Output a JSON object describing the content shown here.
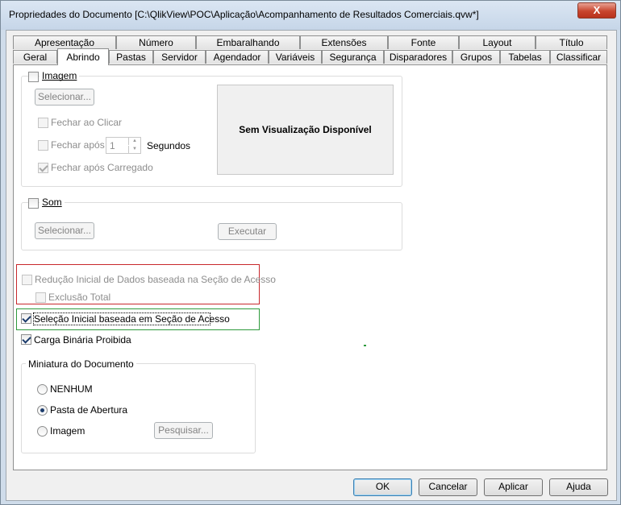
{
  "window": {
    "title": "Propriedades do Documento [C:\\QlikView\\POC\\Aplicação\\Acompanhamento de Resultados Comerciais.qvw*]",
    "close_label": "X"
  },
  "tabs_row1": [
    "Apresentação",
    "Número",
    "Embaralhando",
    "Extensões",
    "Fonte",
    "Layout",
    "Título"
  ],
  "tabs_row2": [
    "Geral",
    "Abrindo",
    "Pastas",
    "Servidor",
    "Agendador",
    "Variáveis",
    "Segurança",
    "Disparadores",
    "Grupos",
    "Tabelas",
    "Classificar"
  ],
  "image_group": {
    "label": "Imagem",
    "select_button": "Selecionar...",
    "close_on_click": "Fechar ao Clicar",
    "close_after": "Fechar após",
    "seconds_value": "1",
    "seconds_label": "Segundos",
    "close_after_loaded": "Fechar após Carregado",
    "preview_text": "Sem Visualização Disponível"
  },
  "sound_group": {
    "label": "Som",
    "select_button": "Selecionar...",
    "execute_button": "Executar"
  },
  "options": {
    "initial_reduction": "Redução Inicial de Dados baseada na Seção de Acesso",
    "total_exclusion": "Exclusão Total",
    "initial_selection": "Seleção Inicial baseada em Seção de Acesso",
    "binary_load": "Carga Binária Proibida"
  },
  "thumbnail_group": {
    "label": "Miniatura do Documento",
    "none": "NENHUM",
    "opening_sheet": "Pasta de Abertura",
    "image": "Imagem",
    "search_button": "Pesquisar..."
  },
  "footer": {
    "ok": "OK",
    "cancel": "Cancelar",
    "apply": "Aplicar",
    "help": "Ajuda"
  }
}
